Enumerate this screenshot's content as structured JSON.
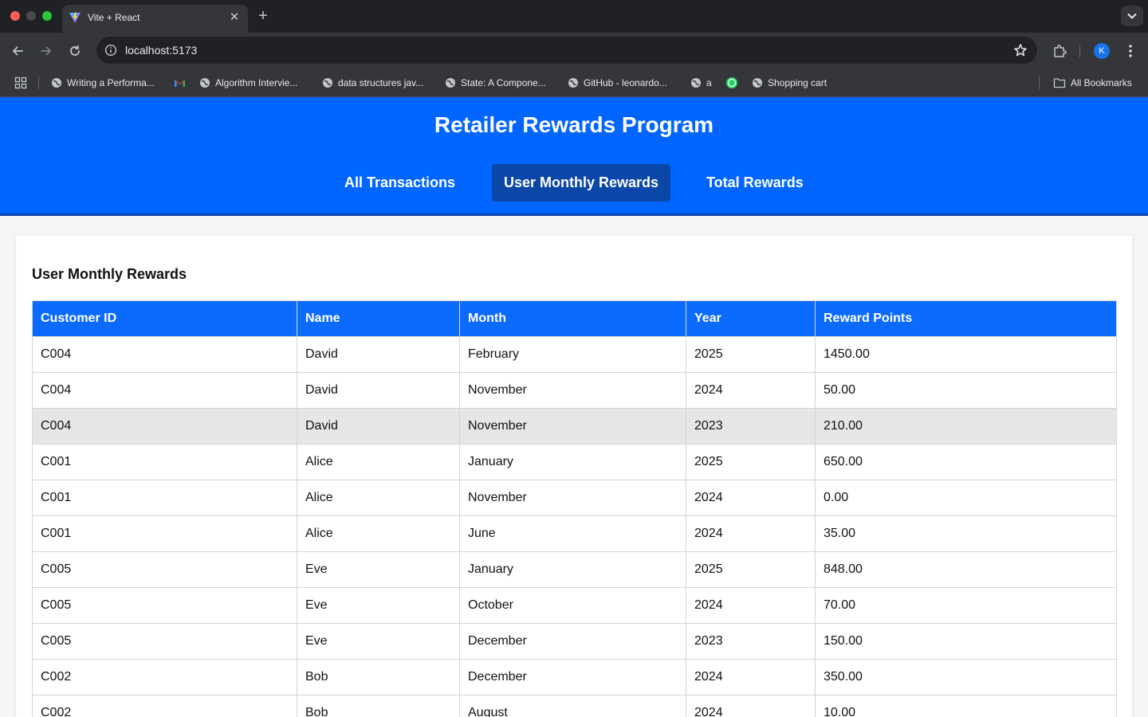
{
  "browser": {
    "tab_title": "Vite + React",
    "url": "localhost:5173",
    "avatar_letter": "K",
    "bookmarks": [
      {
        "label": "Writing a Performa...",
        "icon": "globe-icon"
      },
      {
        "label": "",
        "icon": "gmail-icon"
      },
      {
        "label": "Algorithm Intervie...",
        "icon": "globe-icon"
      },
      {
        "label": "data structures jav...",
        "icon": "globe-icon"
      },
      {
        "label": "State: A Compone...",
        "icon": "globe-icon"
      },
      {
        "label": "GitHub - leonardo...",
        "icon": "globe-icon"
      },
      {
        "label": "a",
        "icon": "globe-icon"
      },
      {
        "label": "",
        "icon": "whatsapp-icon"
      },
      {
        "label": "Shopping cart",
        "icon": "globe-icon"
      }
    ],
    "all_bookmarks": "All Bookmarks"
  },
  "app": {
    "title": "Retailer Rewards Program",
    "nav": [
      "All Transactions",
      "User Monthly Rewards",
      "Total Rewards"
    ],
    "active_nav": "User Monthly Rewards",
    "section_title": "User Monthly Rewards",
    "colors": {
      "primary": "#0066ff",
      "active": "#0b47a8",
      "table_header": "#0b6bff"
    }
  },
  "table": {
    "columns": [
      "Customer ID",
      "Name",
      "Month",
      "Year",
      "Reward Points"
    ],
    "rows": [
      [
        "C004",
        "David",
        "February",
        "2025",
        "1450.00"
      ],
      [
        "C004",
        "David",
        "November",
        "2024",
        "50.00"
      ],
      [
        "C004",
        "David",
        "November",
        "2023",
        "210.00"
      ],
      [
        "C001",
        "Alice",
        "January",
        "2025",
        "650.00"
      ],
      [
        "C001",
        "Alice",
        "November",
        "2024",
        "0.00"
      ],
      [
        "C001",
        "Alice",
        "June",
        "2024",
        "35.00"
      ],
      [
        "C005",
        "Eve",
        "January",
        "2025",
        "848.00"
      ],
      [
        "C005",
        "Eve",
        "October",
        "2024",
        "70.00"
      ],
      [
        "C005",
        "Eve",
        "December",
        "2023",
        "150.00"
      ],
      [
        "C002",
        "Bob",
        "December",
        "2024",
        "350.00"
      ],
      [
        "C002",
        "Bob",
        "August",
        "2024",
        "10.00"
      ]
    ]
  }
}
